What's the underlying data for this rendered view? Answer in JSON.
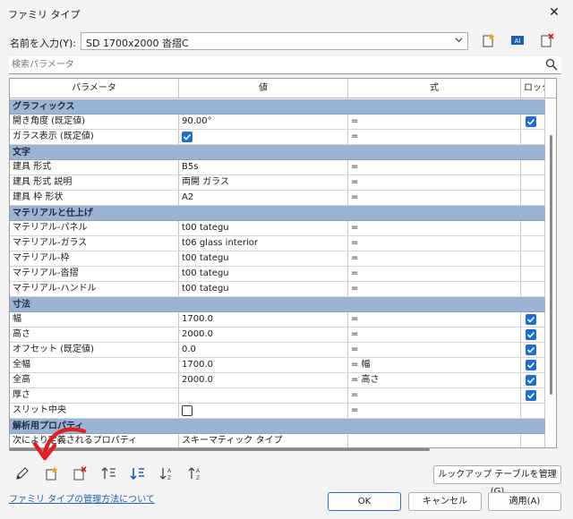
{
  "window": {
    "title": "ファミリ タイプ",
    "close_glyph": "✕"
  },
  "name_row": {
    "label": "名前を入力(Y):",
    "value": "SD 1700x2000 沓摺C"
  },
  "search": {
    "placeholder": "検索パラメータ"
  },
  "columns": [
    "パラメータ",
    "値",
    "式",
    "ロック"
  ],
  "groups": [
    {
      "name": "グラフィックス",
      "rows": [
        {
          "param": "開き角度 (既定値)",
          "value": "90.00°",
          "formula": "=",
          "lock": true
        },
        {
          "param": "ガラス表示 (既定値)",
          "value_checkbox": true,
          "formula": "="
        }
      ]
    },
    {
      "name": "文字",
      "rows": [
        {
          "param": "建具 形式",
          "value": "B5s",
          "formula": "="
        },
        {
          "param": "建具 形式 説明",
          "value": "両開 ガラス",
          "formula": "="
        },
        {
          "param": "建具 枠 形状",
          "value": "A2",
          "formula": "="
        }
      ]
    },
    {
      "name": "マテリアルと仕上げ",
      "rows": [
        {
          "param": "マテリアル-パネル",
          "value": "t00 tategu",
          "formula": "="
        },
        {
          "param": "マテリアル-ガラス",
          "value": "t06 glass interior",
          "formula": "="
        },
        {
          "param": "マテリアル-枠",
          "value": "t00 tategu",
          "formula": "="
        },
        {
          "param": "マテリアル-沓摺",
          "value": "t00 tategu",
          "formula": "="
        },
        {
          "param": "マテリアル-ハンドル",
          "value": "t00 tategu",
          "formula": "="
        }
      ]
    },
    {
      "name": "寸法",
      "rows": [
        {
          "param": "幅",
          "value": "1700.0",
          "formula": "=",
          "lock": true
        },
        {
          "param": "高さ",
          "value": "2000.0",
          "formula": "=",
          "lock": true
        },
        {
          "param": "オフセット (既定値)",
          "value": "0.0",
          "formula": "=",
          "lock": true
        },
        {
          "param": "全幅",
          "value": "1700.0",
          "formula": "= 幅",
          "lock": true
        },
        {
          "param": "全高",
          "value": "2000.0",
          "formula": "= 高さ",
          "lock": true
        },
        {
          "param": "厚さ",
          "value": "",
          "formula": "=",
          "lock": true
        },
        {
          "param": "スリット中央",
          "value_checkbox": false,
          "formula": "="
        }
      ]
    },
    {
      "name": "解析用プロパティ",
      "rows": [
        {
          "param": "次により定義されるプロパティ",
          "value": "スキーマティック タイプ",
          "formula": ""
        }
      ]
    }
  ],
  "buttons": {
    "lookup": "ルックアップ テーブルを管理(G)",
    "help_link": "ファミリ タイプの管理方法について",
    "ok": "OK",
    "cancel": "キャンセル",
    "apply": "適用(A)"
  },
  "colors": {
    "group_header": "#9cb4d3",
    "checkbox": "#1a6ed8",
    "annotation": "#e02020"
  }
}
